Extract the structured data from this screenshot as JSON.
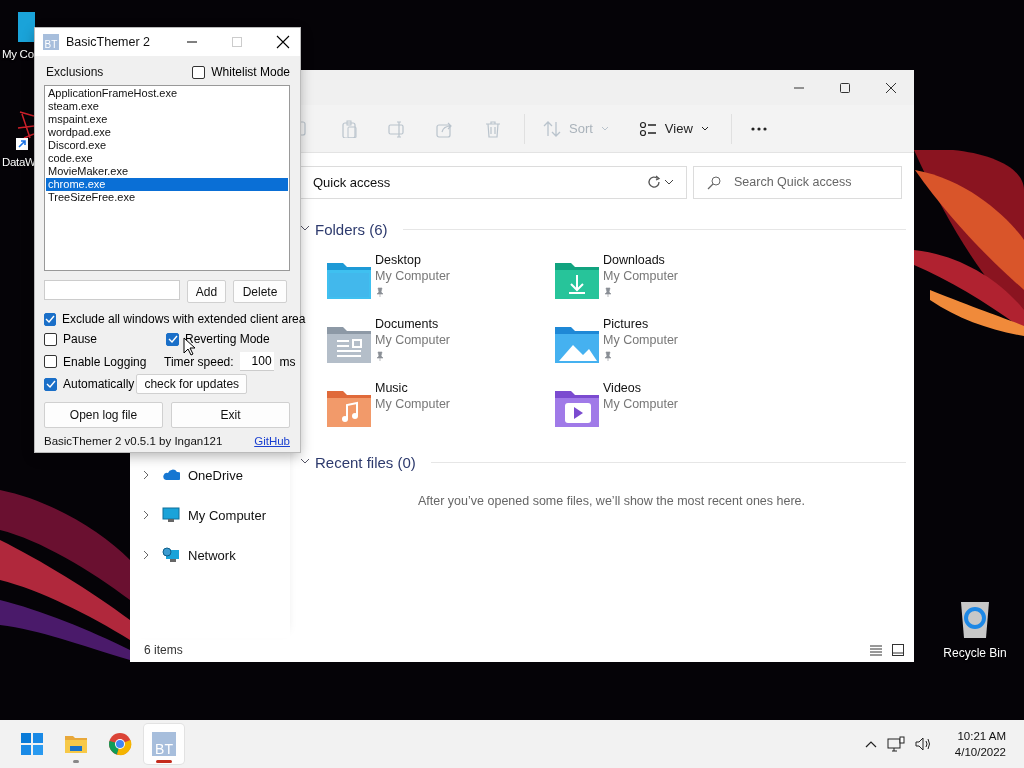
{
  "desktop": {
    "icons": [
      {
        "label": "My Co",
        "kind": "computer"
      },
      {
        "label": "DataW",
        "kind": "app"
      },
      {
        "label": "Recycle Bin",
        "kind": "recycle"
      }
    ]
  },
  "explorer": {
    "toolbar": {
      "buttons": [
        {
          "kind": "copy",
          "disabled": true
        },
        {
          "kind": "paste",
          "disabled": true
        },
        {
          "kind": "rename",
          "disabled": true
        },
        {
          "kind": "share",
          "disabled": true
        },
        {
          "kind": "delete",
          "disabled": true
        },
        {
          "kind": "sort",
          "label": "Sort",
          "disabled": true
        },
        {
          "kind": "view",
          "label": "View",
          "disabled": false
        },
        {
          "kind": "more",
          "disabled": false
        }
      ]
    },
    "address": "Quick access",
    "search": {
      "placeholder": "Search Quick access"
    },
    "nav": [
      {
        "label": "OneDrive",
        "kind": "cloud",
        "expanded": false
      },
      {
        "label": "My Computer",
        "kind": "computer",
        "expanded": false
      },
      {
        "label": "Network",
        "kind": "network",
        "expanded": false
      }
    ],
    "sections": [
      {
        "title": "Folders (6)",
        "expanded": true,
        "folders": [
          {
            "name": "Desktop",
            "location": "My Computer",
            "pinned": true,
            "kind": "desktop"
          },
          {
            "name": "Downloads",
            "location": "My Computer",
            "pinned": true,
            "kind": "downloads"
          },
          {
            "name": "Documents",
            "location": "My Computer",
            "pinned": true,
            "kind": "documents"
          },
          {
            "name": "Pictures",
            "location": "My Computer",
            "pinned": true,
            "kind": "pictures"
          },
          {
            "name": "Music",
            "location": "My Computer",
            "pinned": false,
            "kind": "music"
          },
          {
            "name": "Videos",
            "location": "My Computer",
            "pinned": false,
            "kind": "videos"
          }
        ]
      },
      {
        "title": "Recent files (0)",
        "expanded": true,
        "message": "After you’ve opened some files, we’ll show the most recent ones here."
      }
    ],
    "status": "6 items"
  },
  "basic_themer": {
    "title": "BasicThemer 2",
    "icon_label": "BT",
    "exclusions_label": "Exclusions",
    "whitelist": {
      "label": "Whitelist Mode",
      "checked": false
    },
    "exclusions": [
      {
        "name": "ApplicationFrameHost.exe",
        "selected": false
      },
      {
        "name": "steam.exe",
        "selected": false
      },
      {
        "name": "mspaint.exe",
        "selected": false
      },
      {
        "name": "wordpad.exe",
        "selected": false
      },
      {
        "name": "Discord.exe",
        "selected": false
      },
      {
        "name": "code.exe",
        "selected": false
      },
      {
        "name": "MovieMaker.exe",
        "selected": false
      },
      {
        "name": "chrome.exe",
        "selected": true
      },
      {
        "name": "TreeSizeFree.exe",
        "selected": false
      }
    ],
    "add_button": "Add",
    "delete_button": "Delete",
    "options": {
      "exclude_extended": {
        "label": "Exclude all windows with extended client area",
        "checked": true
      },
      "pause": {
        "label": "Pause",
        "checked": false
      },
      "reverting": {
        "label": "Reverting Mode",
        "checked": true
      },
      "logging": {
        "label": "Enable Logging",
        "checked": false
      },
      "auto_update": {
        "label": "Automatically",
        "checked": true
      }
    },
    "timer_label": "Timer speed:",
    "timer_value": "100",
    "timer_unit": "ms",
    "check_updates_button": "check for updates",
    "open_log_button": "Open log file",
    "exit_button": "Exit",
    "footer": "BasicThemer 2 v0.5.1 by Ingan121",
    "github_link": "GitHub"
  },
  "taskbar": {
    "apps": [
      {
        "kind": "start",
        "running": false,
        "active": false
      },
      {
        "kind": "explorer",
        "running": true,
        "active": false
      },
      {
        "kind": "chrome",
        "running": false,
        "active": false
      },
      {
        "kind": "basicthemer",
        "label": "BT",
        "running": true,
        "active": true
      }
    ],
    "time": "10:21 AM",
    "date": "4/10/2022"
  }
}
